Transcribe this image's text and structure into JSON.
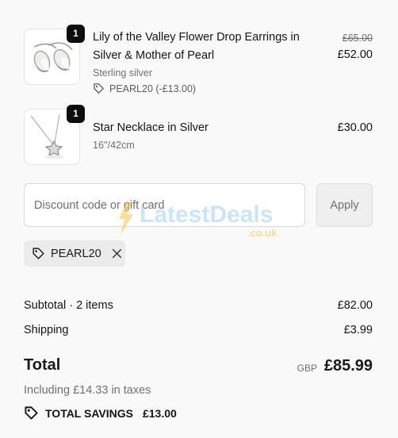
{
  "items": [
    {
      "quantity": "1",
      "title": "Lily of the Valley Flower Drop Earrings in Silver & Mother of Pearl",
      "variant": "Sterling silver",
      "discount_tag": "PEARL20 (-£13.00)",
      "original_price": "£65.00",
      "price": "£52.00",
      "image_icon": "earrings-image"
    },
    {
      "quantity": "1",
      "title": "Star Necklace in Silver",
      "variant": "16''/42cm",
      "price": "£30.00",
      "image_icon": "necklace-image"
    }
  ],
  "discount": {
    "placeholder": "Discount code or gift card",
    "value": "",
    "apply_label": "Apply",
    "applied_code": "PEARL20"
  },
  "watermark": {
    "brand": "LatestDeals",
    "suffix": ".co.uk"
  },
  "summary": {
    "subtotal_label": "Subtotal · 2 items",
    "subtotal_value": "£82.00",
    "shipping_label": "Shipping",
    "shipping_value": "£3.99",
    "total_label": "Total",
    "currency": "GBP",
    "total_value": "£85.99",
    "taxes_note": "Including £14.33 in taxes",
    "savings_label": "TOTAL SAVINGS",
    "savings_value": "£13.00"
  },
  "colors": {
    "background": "#f9f9f9",
    "text": "#141414",
    "muted": "#707070",
    "badge": "#0d0d0d",
    "watermark_blue": "#9fd0f2",
    "watermark_yellow": "#f6c648"
  }
}
